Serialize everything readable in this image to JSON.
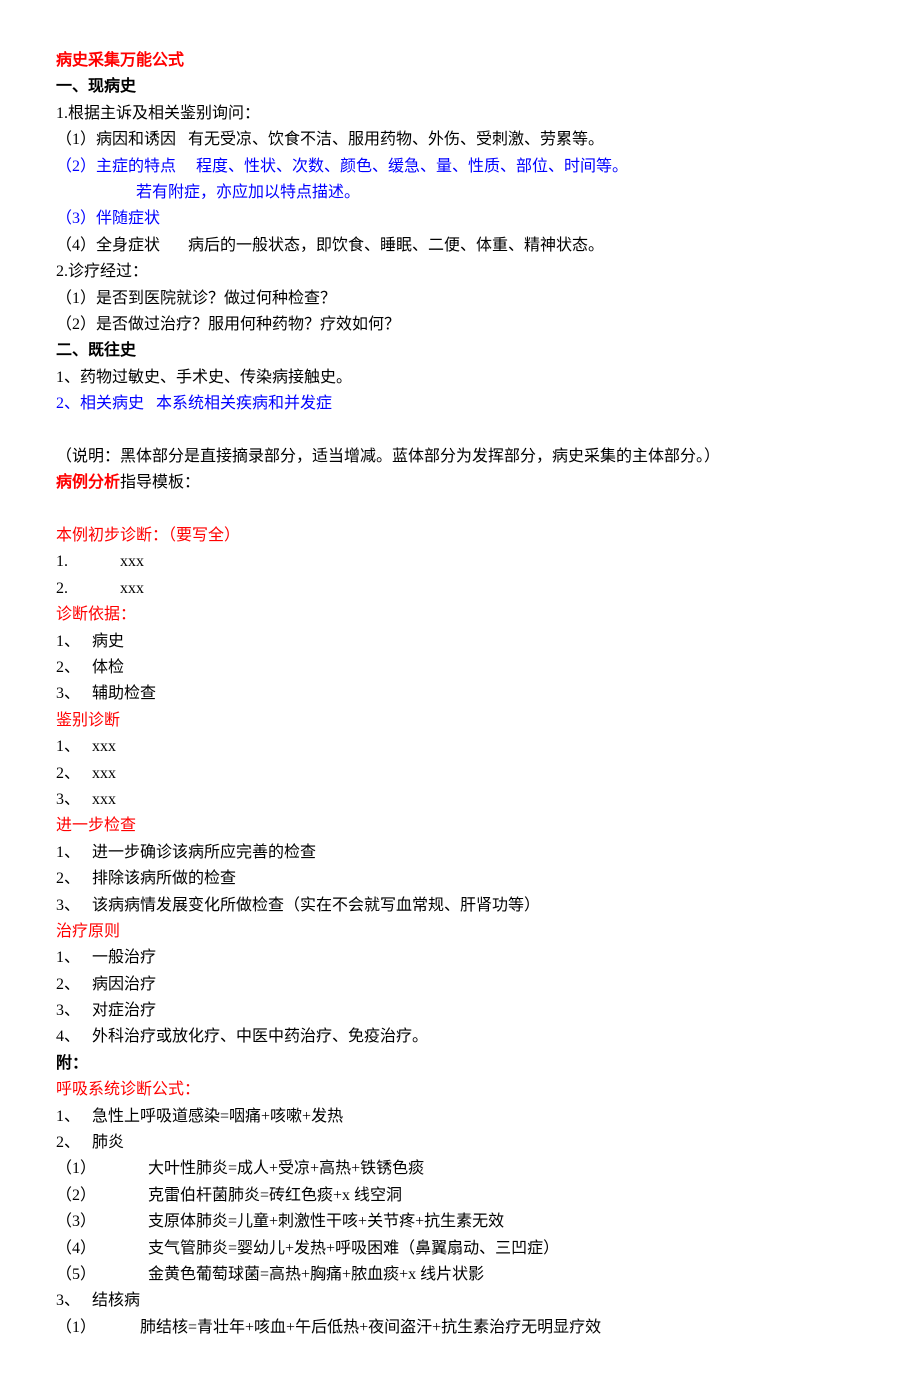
{
  "title1": "病史采集万能公式",
  "section1_heading": "一、现病史",
  "s1_l1": "1.根据主诉及相关鉴别询问：",
  "s1_l2": "（1）病因和诱因   有无受凉、饮食不洁、服用药物、外伤、受刺激、劳累等。",
  "s1_l3": "（2）主症的特点     程度、性状、次数、颜色、缓急、量、性质、部位、时间等。",
  "s1_l3b": "                    若有附症，亦应加以特点描述。",
  "s1_l4": "（3）伴随症状",
  "s1_l5": "（4）全身症状       病后的一般状态，即饮食、睡眠、二便、体重、精神状态。",
  "s1_l6": "2.诊疗经过：",
  "s1_l7": "（1）是否到医院就诊？做过何种检查？",
  "s1_l8": "（2）是否做过治疗？服用何种药物？疗效如何？",
  "section2_heading": "二、既往史",
  "s2_l1": "1、药物过敏史、手术史、传染病接触史。",
  "s2_l2": "2、相关病史   本系统相关疾病和并发症",
  "note": "（说明：黑体部分是直接摘录部分，适当增减。蓝体部分为发挥部分，病史采集的主体部分。）",
  "title2a": "病例分析",
  "title2b": "指导模板：",
  "dx_heading": "本例初步诊断：（要写全）",
  "dx_item1": "1.             xxx",
  "dx_item2": "2.             xxx",
  "basis_heading": "诊断依据：",
  "basis_item1": "1、   病史",
  "basis_item2": "2、   体检",
  "basis_item3": "3、   辅助检查",
  "diff_heading": "鉴别诊断",
  "diff_item1": "1、   xxx",
  "diff_item2": "2、   xxx",
  "diff_item3": "3、   xxx",
  "further_heading": "进一步检查",
  "further_item1": "1、   进一步确诊该病所应完善的检查",
  "further_item2": "2、   排除该病所做的检查",
  "further_item3": "3、   该病病情发展变化所做检查（实在不会就写血常规、肝肾功等）",
  "treat_heading": "治疗原则",
  "treat_item1": "1、   一般治疗",
  "treat_item2": "2、   病因治疗",
  "treat_item3": "3、   对症治疗",
  "treat_item4": "4、   外科治疗或放化疗、中医中药治疗、免疫治疗。",
  "appendix": "附：",
  "resp_heading": "呼吸系统诊断公式：",
  "resp1": "1、   急性上呼吸道感染=咽痛+咳嗽+发热",
  "resp2": "2、   肺炎",
  "resp2_1": "（1）             大叶性肺炎=成人+受凉+高热+铁锈色痰",
  "resp2_2": "（2）             克雷伯杆菌肺炎=砖红色痰+x 线空洞",
  "resp2_3": "（3）             支原体肺炎=儿童+刺激性干咳+关节疼+抗生素无效",
  "resp2_4": "（4）             支气管肺炎=婴幼儿+发热+呼吸困难（鼻翼扇动、三凹症）",
  "resp2_5": "（5）             金黄色葡萄球菌=高热+胸痛+脓血痰+x 线片状影",
  "resp3": "3、   结核病",
  "resp3_1": "（1）           肺结核=青壮年+咳血+午后低热+夜间盗汗+抗生素治疗无明显疗效"
}
